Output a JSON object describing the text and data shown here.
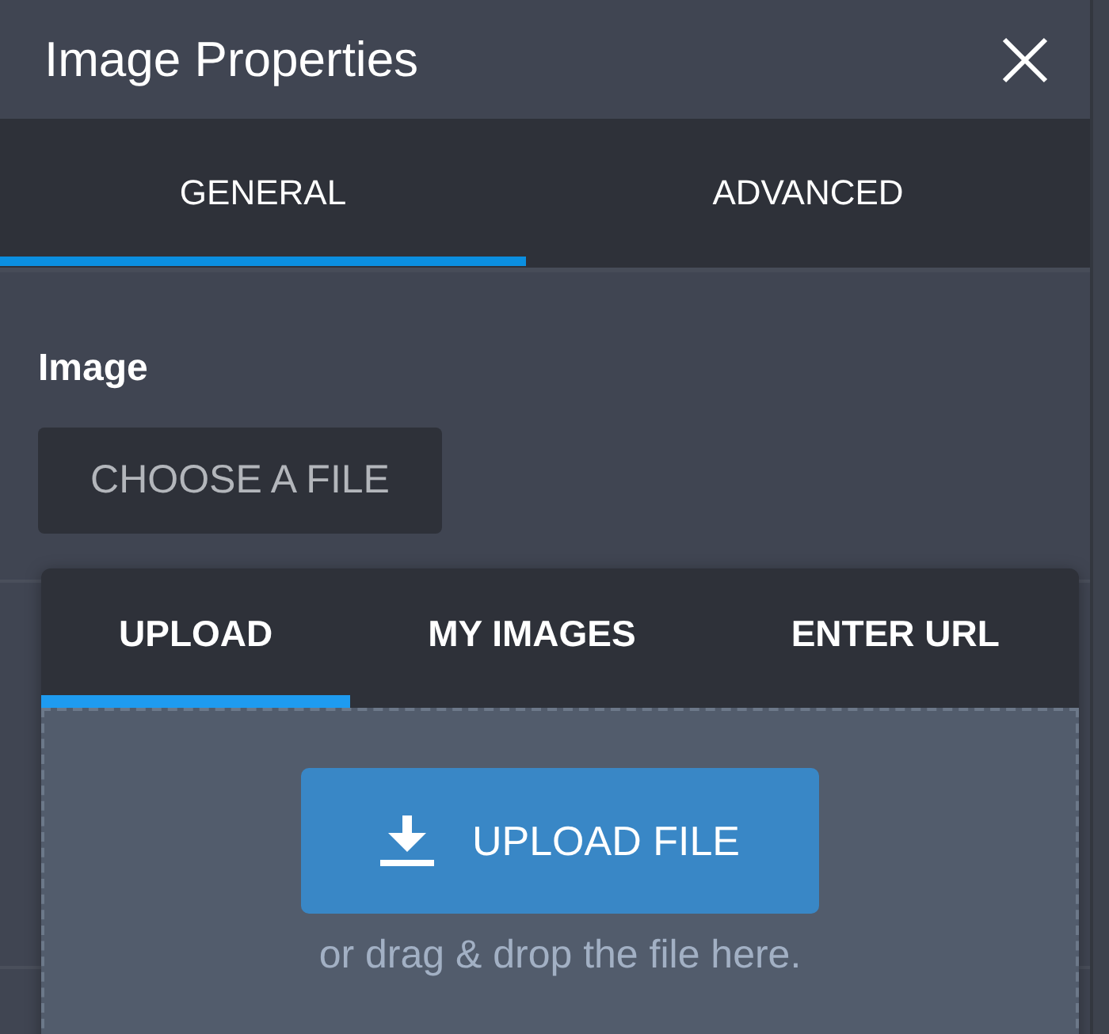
{
  "window": {
    "title": "Image Properties"
  },
  "tabs": [
    {
      "label": "GENERAL",
      "selected": true
    },
    {
      "label": "ADVANCED",
      "selected": false
    }
  ],
  "image_field": {
    "label": "Image",
    "button": "CHOOSE A FILE"
  },
  "upload_popup": {
    "tabs": [
      {
        "label": "UPLOAD",
        "selected": true
      },
      {
        "label": "MY IMAGES",
        "selected": false
      },
      {
        "label": "ENTER URL",
        "selected": false
      }
    ],
    "upload_button": "UPLOAD FILE",
    "hint": "or drag & drop the file here."
  }
}
